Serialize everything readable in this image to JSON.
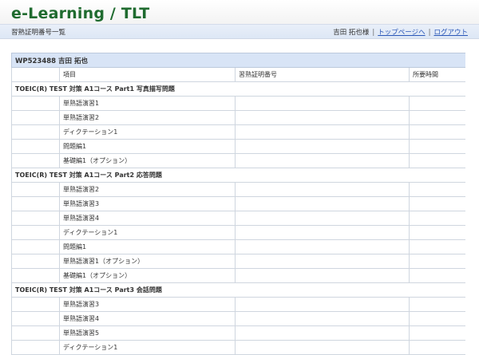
{
  "header": {
    "logo": "e-Learning / TLT",
    "page_title": "習熟証明番号一覧",
    "user_greeting": "吉田 拓也様",
    "top_link": "トップページへ",
    "logout_link": "ログアウト"
  },
  "table": {
    "user_label": "WP523488 吉田 拓也",
    "col_item": "項目",
    "col_number": "習熟証明番号",
    "col_time": "所要時間",
    "sections": [
      {
        "title": "TOEIC(R) TEST 対策 A1コース Part1 写真描写問題",
        "items": [
          "単熟語演習1",
          "単熟語演習2",
          "ディクテーション1",
          "問題編1",
          "基礎編1（オプション）"
        ]
      },
      {
        "title": "TOEIC(R) TEST 対策 A1コース Part2 応答問題",
        "items": [
          "単熟語演習2",
          "単熟語演習3",
          "単熟語演習4",
          "ディクテーション1",
          "問題編1",
          "単熟語演習1（オプション）",
          "基礎編1（オプション）"
        ]
      },
      {
        "title": "TOEIC(R) TEST 対策 A1コース Part3 会話問題",
        "items": [
          "単熟語演習3",
          "単熟語演習4",
          "単熟語演習5",
          "ディクテーション1"
        ]
      }
    ]
  }
}
